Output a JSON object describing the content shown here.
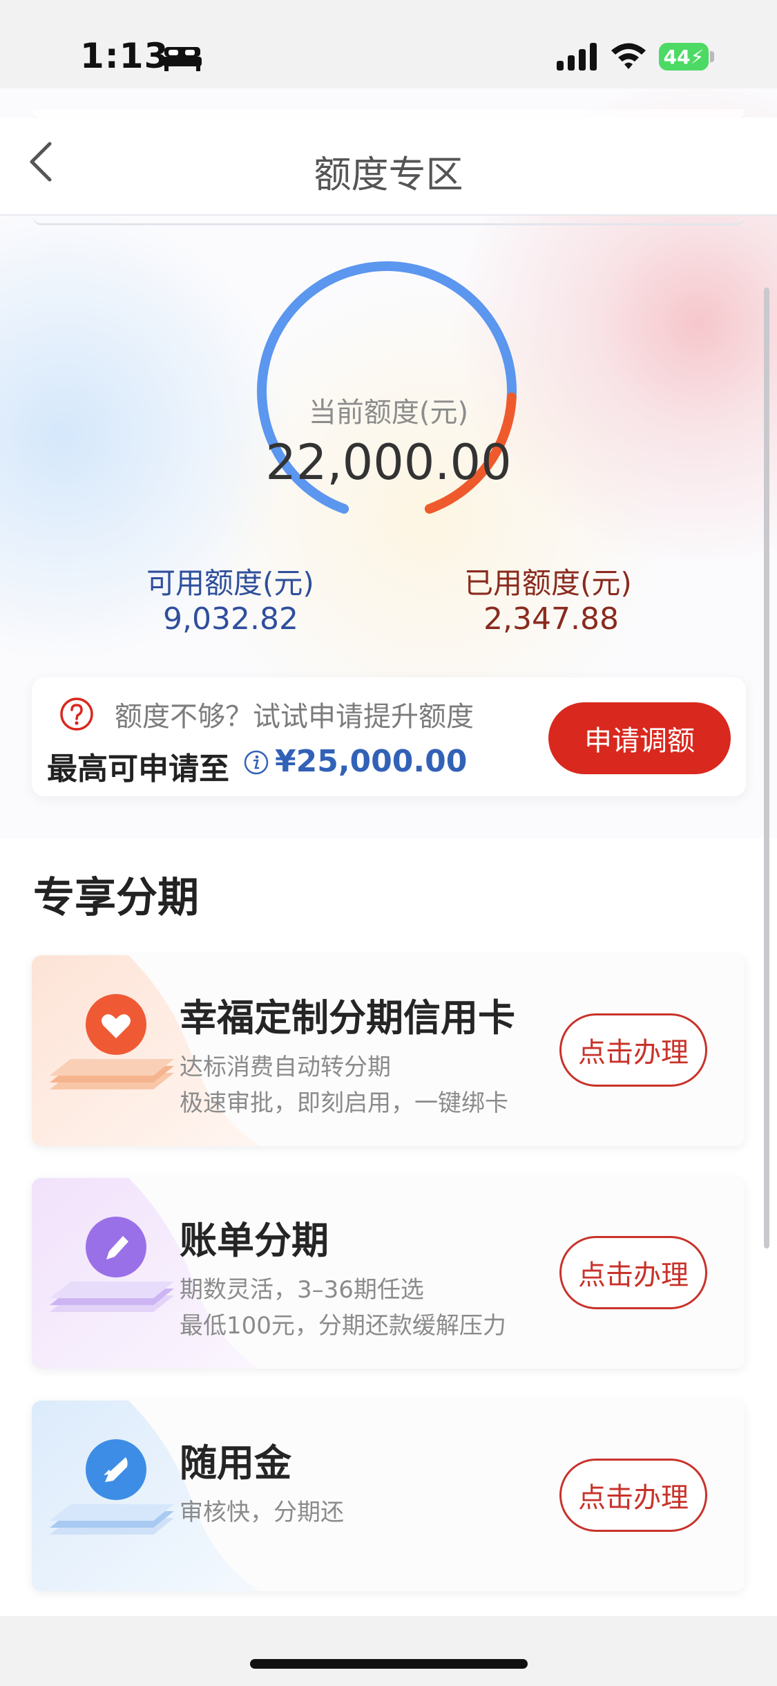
{
  "status_bar": {
    "time": "1:13",
    "battery": "44"
  },
  "nav": {
    "title": "额度专区"
  },
  "gauge": {
    "label": "当前额度(元)",
    "total": "22,000.00",
    "used_fraction": 0.21,
    "colors": {
      "available": "#5b96ef",
      "used": "#ee5a2c"
    }
  },
  "available": {
    "label": "可用额度(元)",
    "value": "9,032.82"
  },
  "used": {
    "label": "已用额度(元)",
    "value": "2,347.88"
  },
  "quota": {
    "hint": "额度不够？试试申请提升额度",
    "max_label": "最高可申请至",
    "max_value": "¥25,000.00",
    "button": "申请调额"
  },
  "section": {
    "title": "专享分期"
  },
  "products": [
    {
      "title": "幸福定制分期信用卡",
      "lines": [
        "达标消费自动转分期",
        "极速审批，即刻启用，一键绑卡"
      ],
      "button": "点击办理",
      "icon": "heart-icon",
      "accent": "#f0603c"
    },
    {
      "title": "账单分期",
      "lines": [
        "期数灵活，3–36期任选",
        "最低100元，分期还款缓解压力"
      ],
      "button": "点击办理",
      "icon": "pencil-icon",
      "accent": "#9a70e8"
    },
    {
      "title": "随用金",
      "lines": [
        "审核快，分期还"
      ],
      "button": "点击办理",
      "icon": "rocket-icon",
      "accent": "#3d8de6"
    }
  ]
}
